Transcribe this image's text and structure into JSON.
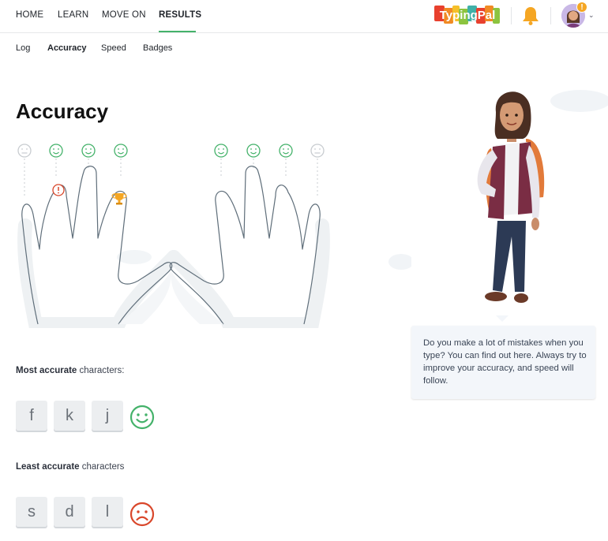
{
  "nav": {
    "items": [
      "HOME",
      "LEARN",
      "MOVE ON",
      "RESULTS"
    ],
    "active": "RESULTS",
    "logo_text": "TypingPal",
    "avatar_badge": "!"
  },
  "subnav": {
    "items": [
      "Log",
      "Accuracy",
      "Speed",
      "Badges"
    ],
    "active": "Accuracy"
  },
  "page_title": "Accuracy",
  "fingers": [
    {
      "hand": "left",
      "finger": "pinky",
      "status": "neutral"
    },
    {
      "hand": "left",
      "finger": "ring",
      "status": "happy",
      "marker": "warning"
    },
    {
      "hand": "left",
      "finger": "middle",
      "status": "happy"
    },
    {
      "hand": "left",
      "finger": "index",
      "status": "happy",
      "marker": "trophy"
    },
    {
      "hand": "right",
      "finger": "index",
      "status": "happy"
    },
    {
      "hand": "right",
      "finger": "middle",
      "status": "happy"
    },
    {
      "hand": "right",
      "finger": "ring",
      "status": "happy"
    },
    {
      "hand": "right",
      "finger": "pinky",
      "status": "neutral"
    }
  ],
  "most_accurate": {
    "label_bold": "Most accurate",
    "label_rest": " characters:",
    "keys": [
      "f",
      "k",
      "j"
    ],
    "face": "happy-face-icon"
  },
  "least_accurate": {
    "label_bold": "Least accurate",
    "label_rest": " characters",
    "keys": [
      "s",
      "d",
      "l"
    ],
    "face": "sad-face-icon"
  },
  "tip": {
    "text": "Do you make a lot of mistakes when you type? You can find out here. Always try to improve your accuracy, and speed will follow."
  },
  "colors": {
    "accent_green": "#44b26a",
    "sad_red": "#d9472b",
    "bell_orange": "#f5a623",
    "neutral_gray": "#c8ccd0"
  }
}
